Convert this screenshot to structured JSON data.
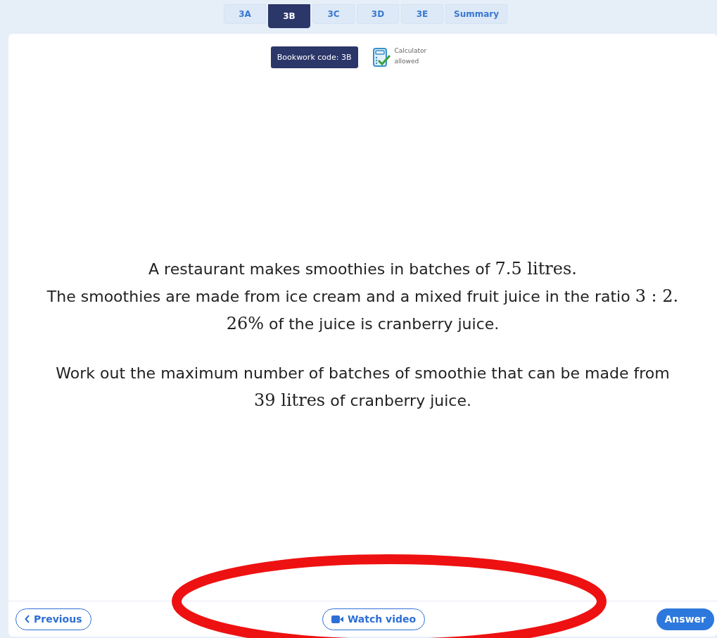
{
  "tabs": [
    {
      "label": "3A",
      "selected": false
    },
    {
      "label": "3B",
      "selected": true
    },
    {
      "label": "3C",
      "selected": false
    },
    {
      "label": "3D",
      "selected": false
    },
    {
      "label": "3E",
      "selected": false
    },
    {
      "label": "Summary",
      "selected": false
    }
  ],
  "bookwork_code": "Bookwork code: 3B",
  "calculator": {
    "line_1": "Calculator",
    "line_2": "allowed"
  },
  "question": [
    [
      {
        "kind": "text",
        "text": "A restaurant makes smoothies in batches of "
      },
      {
        "kind": "math",
        "text": "7.5 litres."
      }
    ],
    [
      {
        "kind": "text",
        "text": "The smoothies are made from ice cream and a mixed fruit juice in the ratio "
      },
      {
        "kind": "math",
        "text": "3 : 2."
      }
    ],
    [
      {
        "kind": "math",
        "text": "26%"
      },
      {
        "kind": "text",
        "text": " of the juice is cranberry juice."
      }
    ],
    [
      {
        "kind": "text",
        "text": "Work out the maximum number of batches of smoothie that can be made from "
      },
      {
        "kind": "math",
        "text": "39 litres"
      },
      {
        "kind": "text",
        "text": " of cranberry juice."
      }
    ]
  ],
  "footer": {
    "previous": "Previous",
    "watch_video": "Watch video",
    "answer": "Answer"
  }
}
